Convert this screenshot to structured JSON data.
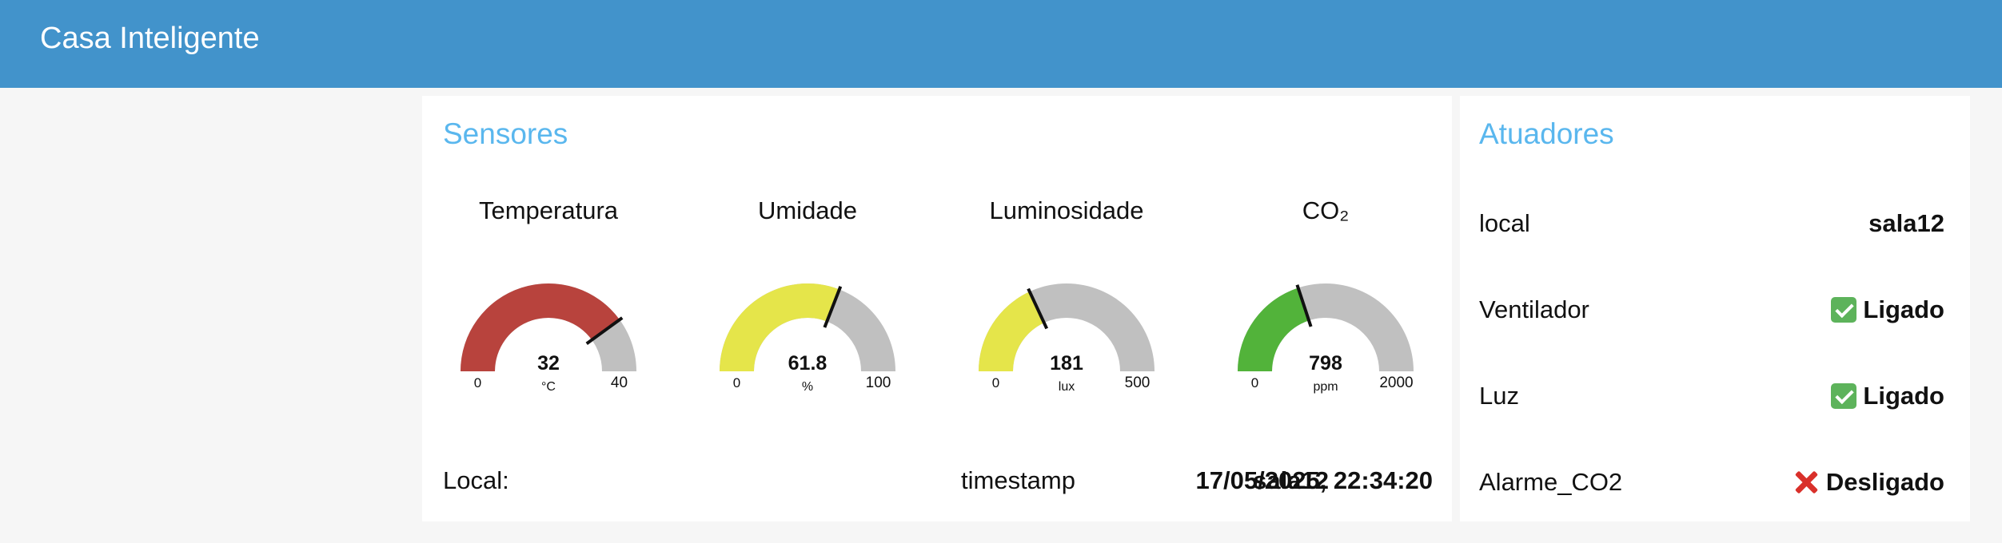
{
  "app": {
    "title": "Casa Inteligente"
  },
  "sensors": {
    "title": "Sensores",
    "gauges": [
      {
        "key": "temp",
        "title": "Temperatura",
        "value": 32,
        "value_text": "32",
        "unit": "°C",
        "min": 0,
        "max": 40,
        "min_text": "0",
        "max_text": "40",
        "color": "#b8433d"
      },
      {
        "key": "hum",
        "title": "Umidade",
        "value": 61.8,
        "value_text": "61.8",
        "unit": "%",
        "min": 0,
        "max": 100,
        "min_text": "0",
        "max_text": "100",
        "color": "#e5e54a"
      },
      {
        "key": "lum",
        "title": "Luminosidade",
        "value": 181,
        "value_text": "181",
        "unit": "lux",
        "min": 0,
        "max": 500,
        "min_text": "0",
        "max_text": "500",
        "color": "#e5e54a"
      },
      {
        "key": "co2",
        "title": "CO₂",
        "value": 798,
        "value_text": "798",
        "unit": "ppm",
        "min": 0,
        "max": 2000,
        "min_text": "0",
        "max_text": "2000",
        "color": "#52b33a"
      }
    ],
    "track_color": "#c0c0c0",
    "local_label": "Local:",
    "local_value": "sala12",
    "timestamp_label": "timestamp",
    "timestamp_value": "17/05/2025, 22:34:20"
  },
  "actuators": {
    "title": "Atuadores",
    "rows": [
      {
        "label": "local",
        "value": "sala12",
        "icon": ""
      },
      {
        "label": "Ventilador",
        "value": "Ligado",
        "icon": "check-icon"
      },
      {
        "label": "Luz",
        "value": "Ligado",
        "icon": "check-icon"
      },
      {
        "label": "Alarme_CO2",
        "value": "Desligado",
        "icon": "cross-icon"
      }
    ]
  }
}
